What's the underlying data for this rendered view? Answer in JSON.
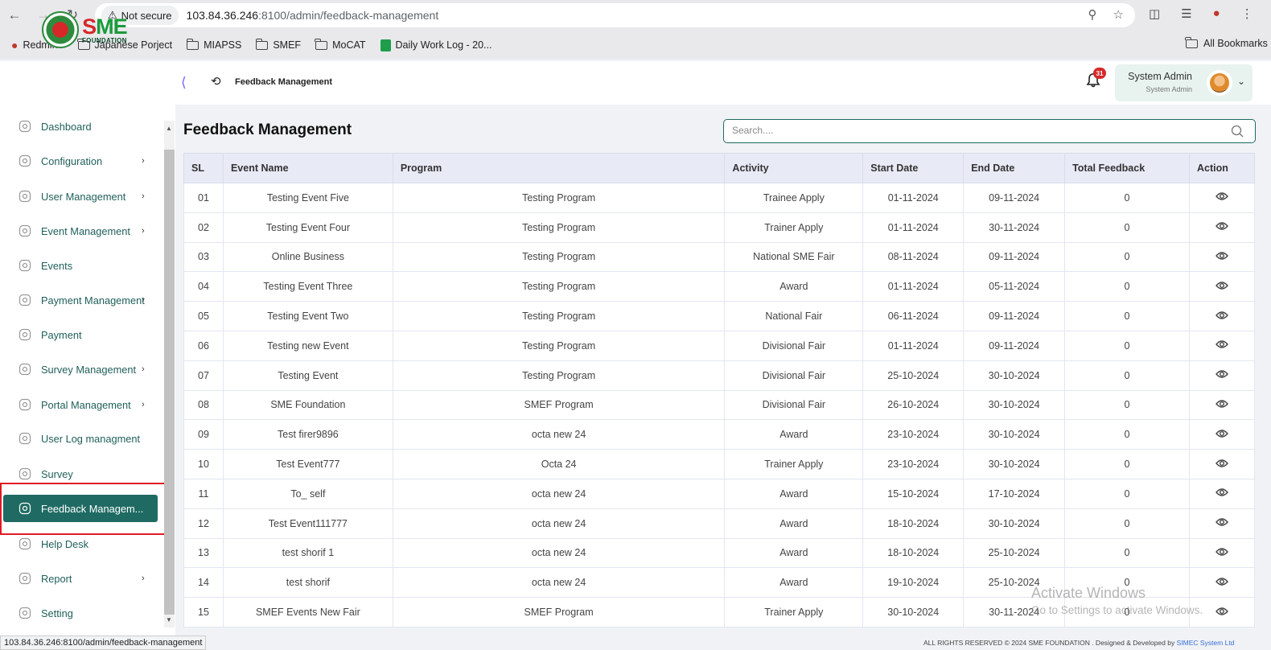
{
  "browser": {
    "security_label": "Not secure",
    "url_host": "103.84.36.246",
    "url_path": ":8100/admin/feedback-management",
    "bookmarks": [
      "Redmine",
      "Japanese Porject",
      "MIAPSS",
      "SMEF",
      "MoCAT",
      "Daily Work Log - 20..."
    ],
    "all_bookmarks": "All Bookmarks",
    "status_url": "103.84.36.246:8100/admin/feedback-management"
  },
  "header": {
    "logo_text": "SME",
    "logo_subtext": "FOUNDATION",
    "breadcrumb": "Feedback Management",
    "notification_count": "31",
    "user_name": "System Admin",
    "user_role": "System Admin"
  },
  "sidebar": {
    "items": [
      {
        "label": "Dashboard",
        "icon": "dashboard-icon",
        "has_submenu": false
      },
      {
        "label": "Configuration",
        "icon": "configuration-icon",
        "has_submenu": true
      },
      {
        "label": "User Management",
        "icon": "user-management-icon",
        "has_submenu": true
      },
      {
        "label": "Event Management",
        "icon": "event-management-icon",
        "has_submenu": true
      },
      {
        "label": "Events",
        "icon": "events-icon",
        "has_submenu": false
      },
      {
        "label": "Payment Management",
        "icon": "payment-management-icon",
        "has_submenu": true
      },
      {
        "label": "Payment",
        "icon": "payment-icon",
        "has_submenu": false
      },
      {
        "label": "Survey Management",
        "icon": "survey-management-icon",
        "has_submenu": true
      },
      {
        "label": "Portal Management",
        "icon": "portal-management-icon",
        "has_submenu": true
      },
      {
        "label": "User Log managment",
        "icon": "user-log-icon",
        "has_submenu": false
      },
      {
        "label": "Survey",
        "icon": "survey-icon",
        "has_submenu": false
      },
      {
        "label": "Feedback Managem...",
        "icon": "feedback-icon",
        "has_submenu": false,
        "active": true
      },
      {
        "label": "Help Desk",
        "icon": "mail-icon",
        "has_submenu": false
      },
      {
        "label": "Report",
        "icon": "report-icon",
        "has_submenu": true
      },
      {
        "label": "Setting",
        "icon": "gear-icon",
        "has_submenu": false
      }
    ]
  },
  "main": {
    "title": "Feedback Management",
    "search_placeholder": "Search....",
    "columns": [
      "SL",
      "Event Name",
      "Program",
      "Activity",
      "Start Date",
      "End Date",
      "Total Feedback",
      "Action"
    ],
    "rows": [
      [
        "01",
        "Testing Event Five",
        "Testing Program",
        "Trainee Apply",
        "01-11-2024",
        "09-11-2024",
        "0"
      ],
      [
        "02",
        "Testing Event Four",
        "Testing Program",
        "Trainer Apply",
        "01-11-2024",
        "30-11-2024",
        "0"
      ],
      [
        "03",
        "Online Business",
        "Testing Program",
        "National SME Fair",
        "08-11-2024",
        "09-11-2024",
        "0"
      ],
      [
        "04",
        "Testing Event Three",
        "Testing Program",
        "Award",
        "01-11-2024",
        "05-11-2024",
        "0"
      ],
      [
        "05",
        "Testing Event Two",
        "Testing Program",
        "National Fair",
        "06-11-2024",
        "09-11-2024",
        "0"
      ],
      [
        "06",
        "Testing new Event",
        "Testing Program",
        "Divisional Fair",
        "01-11-2024",
        "09-11-2024",
        "0"
      ],
      [
        "07",
        "Testing Event",
        "Testing Program",
        "Divisional Fair",
        "25-10-2024",
        "30-10-2024",
        "0"
      ],
      [
        "08",
        "SME Foundation",
        "SMEF Program",
        "Divisional Fair",
        "26-10-2024",
        "30-10-2024",
        "0"
      ],
      [
        "09",
        "Test firer9896",
        "octa new 24",
        "Award",
        "23-10-2024",
        "30-10-2024",
        "0"
      ],
      [
        "10",
        "Test Event777",
        "Octa 24",
        "Trainer Apply",
        "23-10-2024",
        "30-10-2024",
        "0"
      ],
      [
        "11",
        "To_ self",
        "octa new 24",
        "Award",
        "15-10-2024",
        "17-10-2024",
        "0"
      ],
      [
        "12",
        "Test Event111777",
        "octa new 24",
        "Award",
        "18-10-2024",
        "30-10-2024",
        "0"
      ],
      [
        "13",
        "test shorif 1",
        "octa new 24",
        "Award",
        "18-10-2024",
        "25-10-2024",
        "0"
      ],
      [
        "14",
        "test shorif",
        "octa new 24",
        "Award",
        "19-10-2024",
        "25-10-2024",
        "0"
      ],
      [
        "15",
        "SMEF Events New Fair",
        "SMEF Program",
        "Trainer Apply",
        "30-10-2024",
        "30-11-2024",
        "0"
      ]
    ]
  },
  "watermark": {
    "line1": "Activate Windows",
    "line2": "Go to Settings to activate Windows."
  },
  "footer": {
    "text": "ALL RIGHTS RESERVED © 2024 SME FOUNDATION . Designed & Developed by",
    "link": "SIMEC System Ltd"
  },
  "colors": {
    "accent": "#1f6b63",
    "highlight": "#e01b24",
    "badge": "#d62828"
  }
}
